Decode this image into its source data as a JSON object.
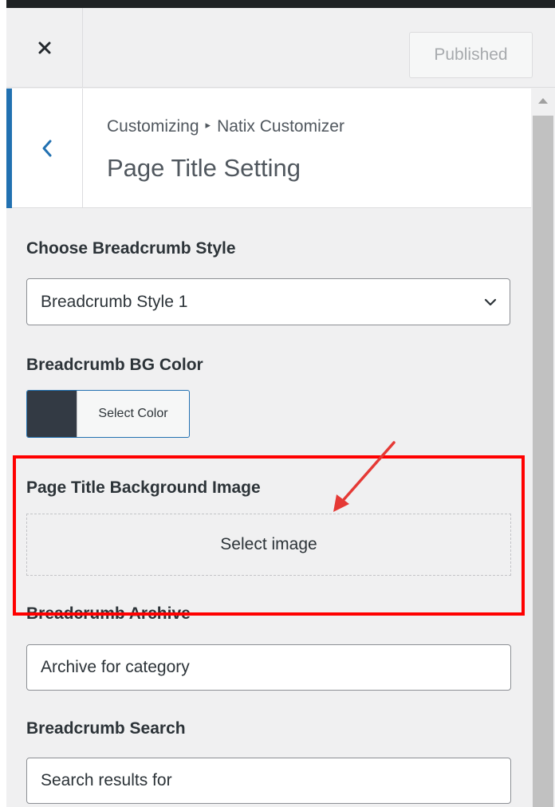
{
  "header": {
    "close_icon": "close-icon",
    "publish_label": "Published"
  },
  "section": {
    "breadcrumb_parent": "Customizing",
    "breadcrumb_separator": "▸",
    "breadcrumb_current": "Natix Customizer",
    "title": "Page Title Setting",
    "accent_color": "#2271b1"
  },
  "controls": {
    "breadcrumb_style": {
      "label": "Choose Breadcrumb Style",
      "value": "Breadcrumb Style 1"
    },
    "bg_color": {
      "label": "Breadcrumb BG Color",
      "button_label": "Select Color",
      "swatch_color": "#333a44"
    },
    "bg_image": {
      "label": "Page Title Background Image",
      "button_label": "Select image",
      "highlight_color": "#ff0000"
    },
    "archive": {
      "label": "Breadcrumb Archive",
      "value": "Archive for category"
    },
    "search": {
      "label": "Breadcrumb Search",
      "value": "Search results for"
    }
  }
}
